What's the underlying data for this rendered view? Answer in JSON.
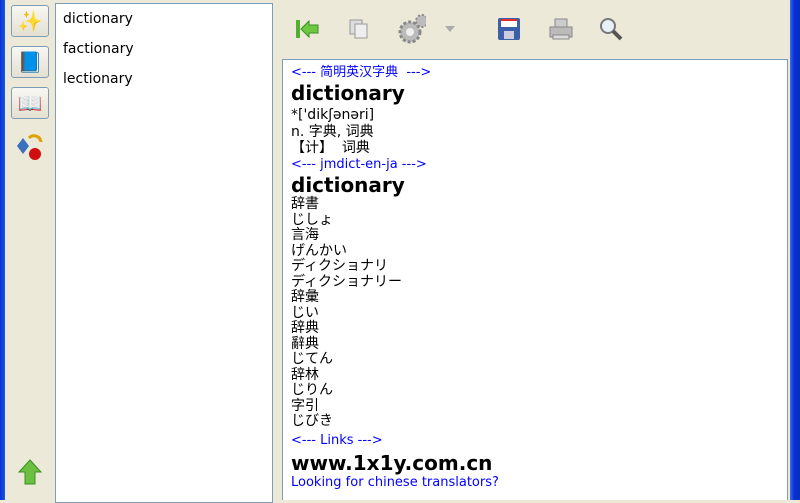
{
  "left_toolbar": {
    "buttons": [
      {
        "icon": "magic-wand-icon"
      },
      {
        "icon": "book-list-icon"
      },
      {
        "icon": "book-translate-icon"
      },
      {
        "icon": "shapes-icon"
      }
    ],
    "bottom_icon": "up-arrow-icon"
  },
  "word_list": [
    "dictionary",
    "factionary",
    "lectionary"
  ],
  "toolbar": {
    "buttons": [
      "back-icon",
      "copy-icon",
      "settings-icon",
      "dropdown-icon",
      "save-icon",
      "print-icon",
      "search-icon"
    ]
  },
  "content": {
    "section1_header": "<--- 简明英汉字典  --->",
    "section1_word": "dictionary",
    "section1_phonetic": "*['dikʃənəri]",
    "section1_def1": "n. 字典, 词典",
    "section1_def2": "【计】  词典",
    "section2_header": "<--- jmdict-en-ja --->",
    "section2_word": "dictionary",
    "section2_lines": [
      "辞書",
      "じしょ",
      "言海",
      "げんかい",
      "ディクショナリ",
      "ディクショナリー",
      "辞彙",
      "じい",
      "辞典",
      "辭典",
      "じてん",
      "辞林",
      "じりん",
      "字引",
      "じびき"
    ],
    "links_header": "<--- Links --->",
    "site": "www.1x1y.com.cn",
    "link_text": "Looking for chinese translators?"
  }
}
